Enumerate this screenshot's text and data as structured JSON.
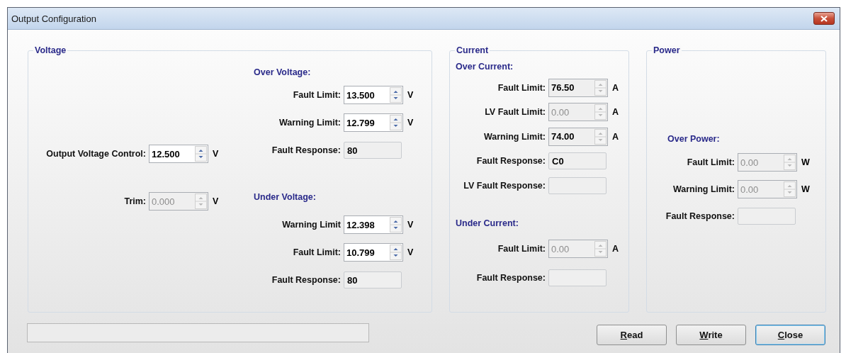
{
  "window": {
    "title": "Output Configuration"
  },
  "voltage": {
    "title": "Voltage",
    "fields": [
      {
        "label": "Output Voltage Control:",
        "kind": "spin",
        "value": "12.500",
        "unit": "V",
        "disabled": false,
        "readonly": false
      },
      {
        "label": "Trim:",
        "kind": "spin",
        "value": "0.000",
        "unit": "V",
        "disabled": true,
        "readonly": true
      }
    ],
    "sections": [
      {
        "heading": "Over Voltage:",
        "fields": [
          {
            "label": "Fault Limit:",
            "kind": "spin",
            "value": "13.500",
            "unit": "V",
            "disabled": false,
            "readonly": false
          },
          {
            "label": "Warning Limit:",
            "kind": "spin",
            "value": "12.799",
            "unit": "V",
            "disabled": false,
            "readonly": false
          },
          {
            "label": "Fault Response:",
            "kind": "text",
            "value": "80",
            "disabled": false,
            "readonly": true
          }
        ]
      },
      {
        "heading": "Under Voltage:",
        "fields": [
          {
            "label": "Warning Limit",
            "kind": "spin",
            "value": "12.398",
            "unit": "V",
            "disabled": false,
            "readonly": false
          },
          {
            "label": "Fault Limit:",
            "kind": "spin",
            "value": "10.799",
            "unit": "V",
            "disabled": false,
            "readonly": false
          },
          {
            "label": "Fault Response:",
            "kind": "text",
            "value": "80",
            "disabled": false,
            "readonly": true
          }
        ]
      }
    ]
  },
  "current": {
    "title": "Current",
    "sections": [
      {
        "heading": "Over Current:",
        "fields": [
          {
            "label": "Fault Limit:",
            "kind": "spin",
            "value": "76.50",
            "unit": "A",
            "disabled": false,
            "readonly": true
          },
          {
            "label": "LV Fault Limit:",
            "kind": "spin",
            "value": "0.00",
            "unit": "A",
            "disabled": true,
            "readonly": true
          },
          {
            "label": "Warning Limit:",
            "kind": "spin",
            "value": "74.00",
            "unit": "A",
            "disabled": false,
            "readonly": true
          },
          {
            "label": "Fault Response:",
            "kind": "text",
            "value": "C0",
            "disabled": false,
            "readonly": true
          },
          {
            "label": "LV Fault Response:",
            "kind": "text",
            "disabled": false,
            "readonly": true
          }
        ]
      },
      {
        "heading": "Under Current:",
        "fields": [
          {
            "label": "Fault Limit:",
            "kind": "spin",
            "value": "0.00",
            "unit": "A",
            "disabled": true,
            "readonly": true
          },
          {
            "label": "Fault Response:",
            "kind": "text",
            "disabled": false,
            "readonly": true
          }
        ]
      }
    ]
  },
  "power": {
    "title": "Power",
    "sections": [
      {
        "heading": "Over Power:",
        "fields": [
          {
            "label": "Fault Limit:",
            "kind": "spin",
            "value": "0.00",
            "unit": "W",
            "disabled": true,
            "readonly": true
          },
          {
            "label": "Warning Limit:",
            "kind": "spin",
            "value": "0.00",
            "unit": "W",
            "disabled": true,
            "readonly": true
          },
          {
            "label": "Fault Response:",
            "kind": "text",
            "disabled": false,
            "readonly": true
          }
        ]
      }
    ]
  },
  "buttons": [
    {
      "label": "Read",
      "underline_first": true,
      "default": false
    },
    {
      "label": "Write",
      "underline_first": true,
      "default": false
    },
    {
      "label": "Close",
      "underline_first": true,
      "default": true
    }
  ]
}
